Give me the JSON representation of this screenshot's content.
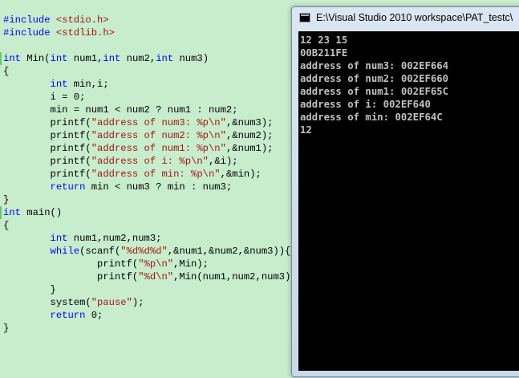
{
  "editor": {
    "lines": [
      {
        "parts": [
          {
            "t": "#include ",
            "c": "pp"
          },
          {
            "t": "<stdio.h>",
            "c": "inc"
          }
        ]
      },
      {
        "parts": [
          {
            "t": "#include ",
            "c": "pp"
          },
          {
            "t": "<stdlib.h>",
            "c": "inc"
          }
        ]
      },
      {
        "parts": []
      },
      {
        "parts": [
          {
            "t": "int",
            "c": "kw"
          },
          {
            "t": " Min("
          },
          {
            "t": "int",
            "c": "kw"
          },
          {
            "t": " num1,"
          },
          {
            "t": "int",
            "c": "kw"
          },
          {
            "t": " num2,"
          },
          {
            "t": "int",
            "c": "kw"
          },
          {
            "t": " num3)"
          }
        ]
      },
      {
        "parts": [
          {
            "t": "{"
          }
        ]
      },
      {
        "parts": [
          {
            "t": "        "
          },
          {
            "t": "int",
            "c": "kw"
          },
          {
            "t": " min,i;"
          }
        ]
      },
      {
        "parts": [
          {
            "t": "        i = 0;"
          }
        ]
      },
      {
        "parts": [
          {
            "t": "        min = num1 < num2 ? num1 : num2;"
          }
        ]
      },
      {
        "parts": [
          {
            "t": "        printf("
          },
          {
            "t": "\"address of num3: %p\\n\"",
            "c": "str"
          },
          {
            "t": ",&num3);"
          }
        ]
      },
      {
        "parts": [
          {
            "t": "        printf("
          },
          {
            "t": "\"address of num2: %p\\n\"",
            "c": "str"
          },
          {
            "t": ",&num2);"
          }
        ]
      },
      {
        "parts": [
          {
            "t": "        printf("
          },
          {
            "t": "\"address of num1: %p\\n\"",
            "c": "str"
          },
          {
            "t": ",&num1);"
          }
        ]
      },
      {
        "parts": [
          {
            "t": "        printf("
          },
          {
            "t": "\"address of i: %p\\n\"",
            "c": "str"
          },
          {
            "t": ",&i);"
          }
        ]
      },
      {
        "parts": [
          {
            "t": "        printf("
          },
          {
            "t": "\"address of min: %p\\n\"",
            "c": "str"
          },
          {
            "t": ",&min);"
          }
        ]
      },
      {
        "parts": [
          {
            "t": "        "
          },
          {
            "t": "return",
            "c": "kw"
          },
          {
            "t": " min < num3 ? min : num3;"
          }
        ]
      },
      {
        "parts": [
          {
            "t": "}"
          }
        ]
      },
      {
        "parts": [
          {
            "t": "int",
            "c": "kw"
          },
          {
            "t": " main()"
          }
        ]
      },
      {
        "parts": [
          {
            "t": "{"
          }
        ]
      },
      {
        "parts": [
          {
            "t": "        "
          },
          {
            "t": "int",
            "c": "kw"
          },
          {
            "t": " num1,num2,num3;"
          }
        ]
      },
      {
        "parts": [
          {
            "t": "        "
          },
          {
            "t": "while",
            "c": "kw"
          },
          {
            "t": "(scanf("
          },
          {
            "t": "\"%d%d%d\"",
            "c": "str"
          },
          {
            "t": ",&num1,&num2,&num3)){"
          }
        ]
      },
      {
        "parts": [
          {
            "t": "                printf("
          },
          {
            "t": "\"%p\\n\"",
            "c": "str"
          },
          {
            "t": ",Min);"
          }
        ]
      },
      {
        "parts": [
          {
            "t": "                printf("
          },
          {
            "t": "\"%d\\n\"",
            "c": "str"
          },
          {
            "t": ",Min(num1,num2,num3));"
          }
        ]
      },
      {
        "parts": [
          {
            "t": "        }"
          }
        ]
      },
      {
        "parts": [
          {
            "t": "        system("
          },
          {
            "t": "\"pause\"",
            "c": "str"
          },
          {
            "t": ");"
          }
        ]
      },
      {
        "parts": [
          {
            "t": "        "
          },
          {
            "t": "return",
            "c": "kw"
          },
          {
            "t": " 0;"
          }
        ]
      },
      {
        "parts": [
          {
            "t": "}"
          }
        ]
      }
    ]
  },
  "console": {
    "title": "E:\\Visual Studio 2010 workspace\\PAT_testc\\",
    "icon": "console-icon",
    "output": [
      "12 23 15",
      "00B211FE",
      "address of num3: 002EF664",
      "address of num2: 002EF660",
      "address of num1: 002EF65C",
      "address of i: 002EF640",
      "address of min: 002EF64C",
      "12"
    ]
  },
  "colors": {
    "editor_bg": "#c7edcc",
    "keyword": "#0000ff",
    "string": "#a31515",
    "console_bg": "#000000",
    "console_text": "#c0c0c0"
  }
}
